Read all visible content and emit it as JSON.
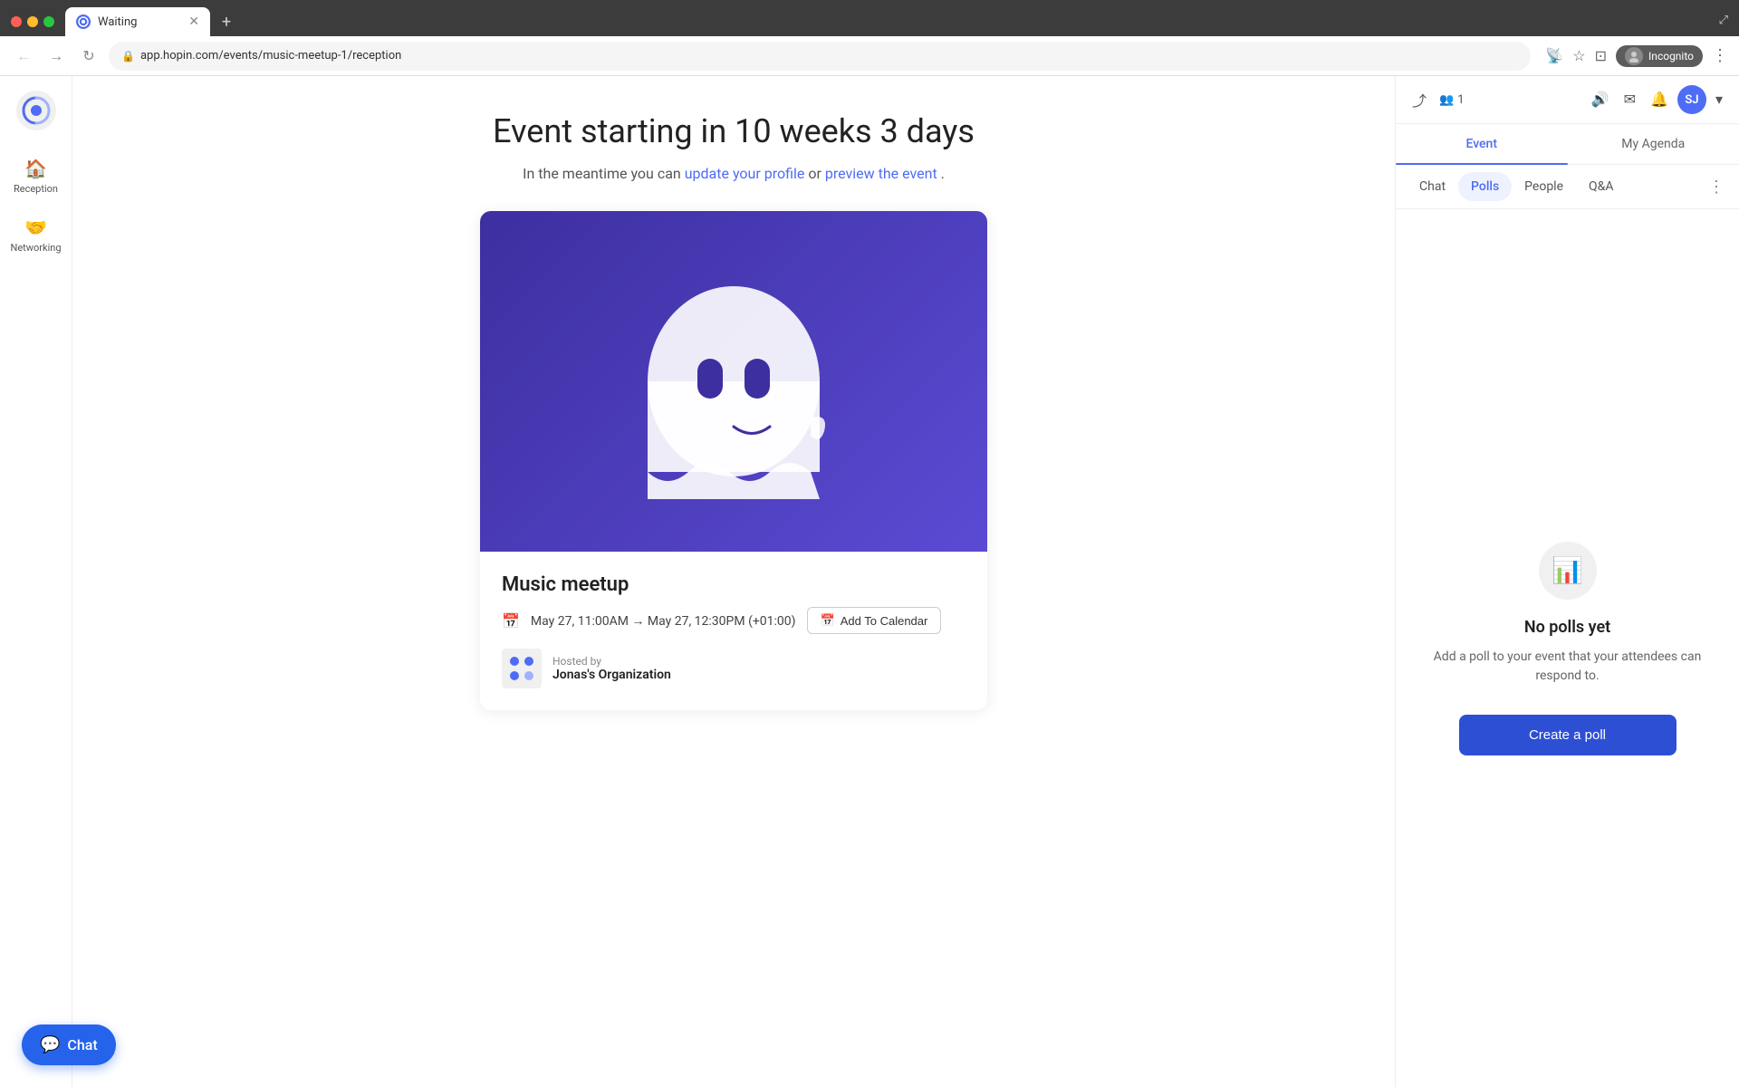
{
  "browser": {
    "tab_title": "Waiting",
    "tab_favicon_alt": "hopin-icon",
    "address_url": "app.hopin.com/events/music-meetup-1/reception",
    "incognito_label": "Incognito"
  },
  "sidebar": {
    "logo_alt": "hopin-logo",
    "items": [
      {
        "id": "reception",
        "label": "Reception",
        "active": true
      },
      {
        "id": "networking",
        "label": "Networking",
        "active": false
      }
    ]
  },
  "main": {
    "countdown_text": "Event starting in 10 weeks 3 days",
    "subtitle_pre": "In the meantime you can ",
    "update_profile_link": "update your profile",
    "subtitle_mid": " or ",
    "preview_event_link": "preview the event",
    "subtitle_post": ".",
    "event": {
      "title": "Music meetup",
      "image_alt": "event-banner",
      "date_text": "May 27, 11:00AM → May 27, 12:30PM (+01:00)",
      "add_calendar_label": "Add To Calendar",
      "hosted_by_label": "Hosted by",
      "host_name": "Jonas's Organization"
    }
  },
  "chat_bubble": {
    "label": "Chat"
  },
  "right_panel": {
    "attendee_count": "1",
    "tabs": [
      {
        "id": "event",
        "label": "Event",
        "active": true
      },
      {
        "id": "my_agenda",
        "label": "My Agenda",
        "active": false
      }
    ],
    "sub_tabs": [
      {
        "id": "chat",
        "label": "Chat",
        "active": false
      },
      {
        "id": "polls",
        "label": "Polls",
        "active": true
      },
      {
        "id": "people",
        "label": "People",
        "active": false
      },
      {
        "id": "qa",
        "label": "Q&A",
        "active": false
      }
    ],
    "polls": {
      "no_polls_title": "No polls yet",
      "no_polls_desc": "Add a poll to your event that your attendees can respond to.",
      "create_poll_label": "Create a poll"
    },
    "user_avatar_initials": "SJ"
  }
}
